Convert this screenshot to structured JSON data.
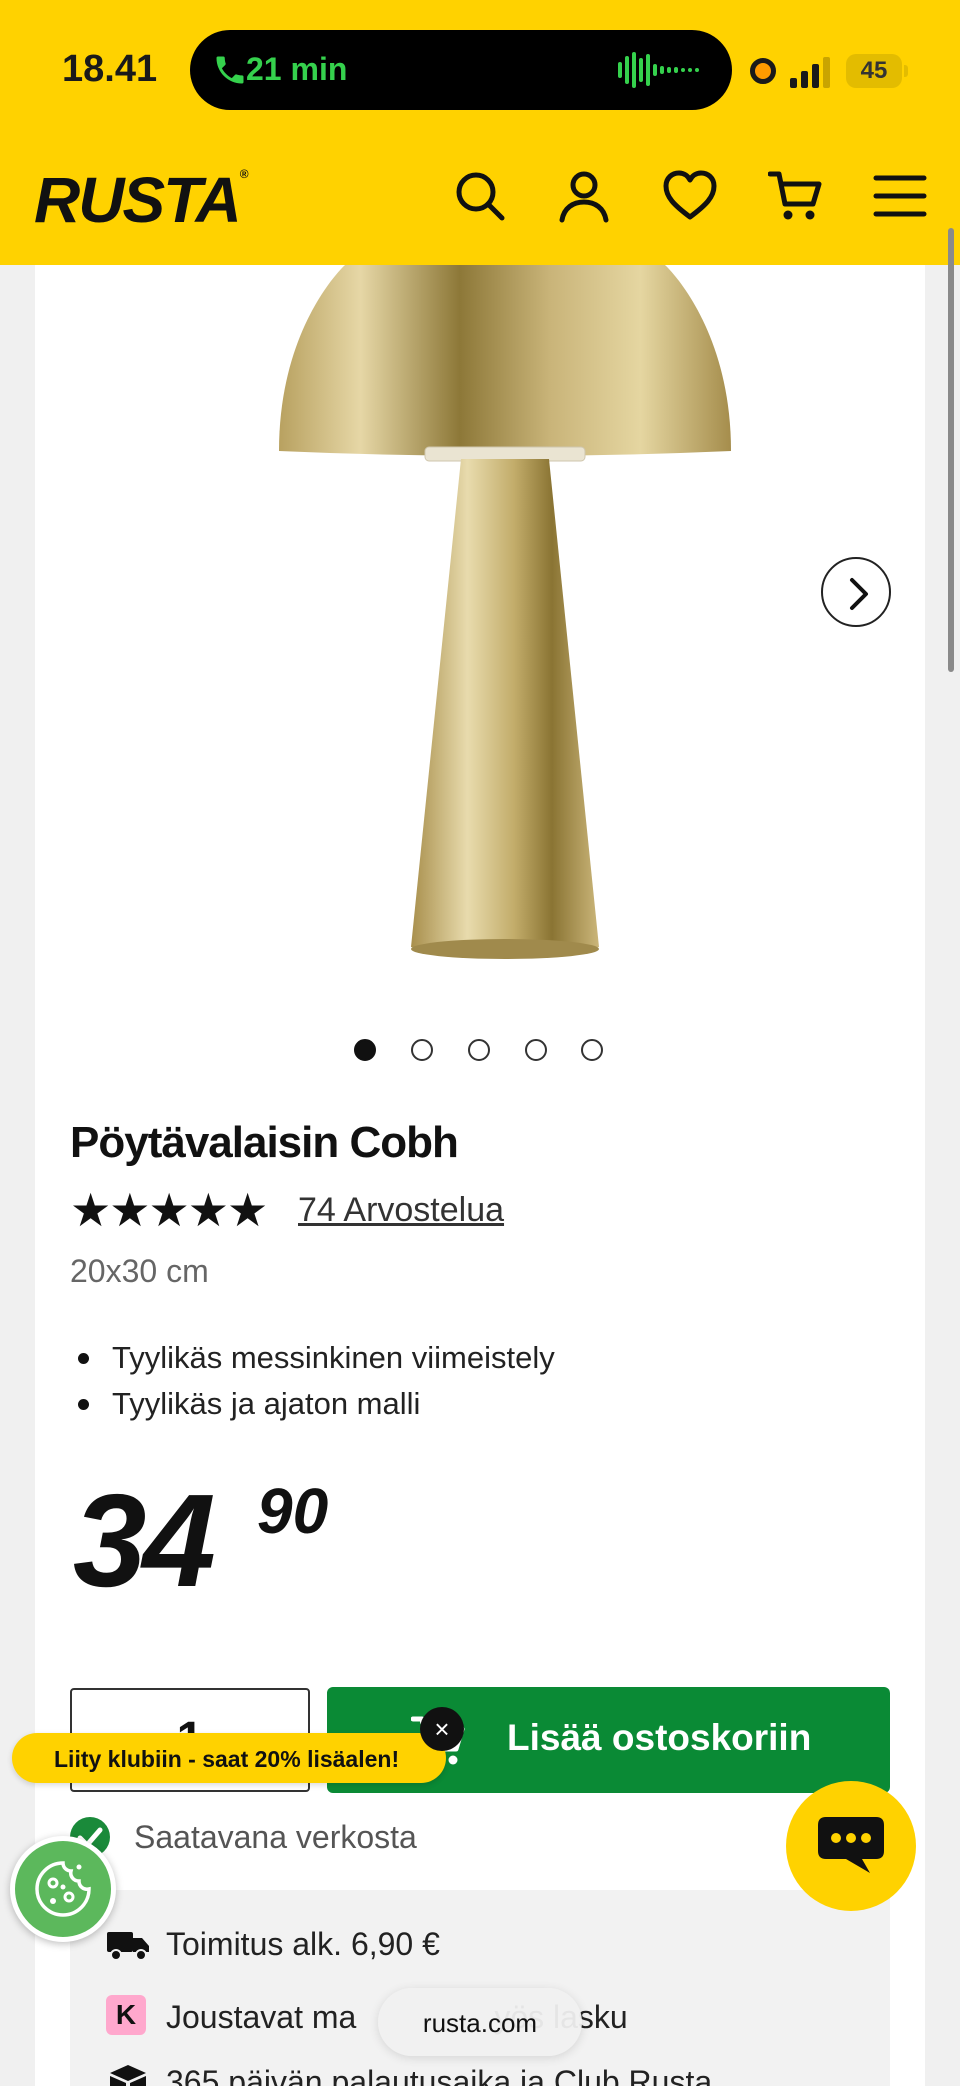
{
  "status_bar": {
    "time": "18.41",
    "call_duration": "21 min",
    "battery": "45"
  },
  "header": {
    "logo": "RUSTA",
    "icons": [
      "search-icon",
      "account-icon",
      "heart-icon",
      "cart-icon",
      "menu-icon"
    ]
  },
  "product": {
    "carousel_index": 1,
    "carousel_count": 5,
    "title": "Pöytävalaisin Cobh",
    "rating_stars": "★★★★★",
    "rating_value": 5,
    "reviews_label": "74 Arvostelua",
    "size": "20x30 cm",
    "features": [
      "Tyylikäs messinkinen viimeistely",
      "Tyylikäs ja ajaton malli"
    ],
    "price_whole": "34",
    "price_cents": "90"
  },
  "purchase": {
    "quantity": "1",
    "add_to_cart_label": "Lisää ostoskoriin",
    "availability": "Saatavana verkosta"
  },
  "info": {
    "delivery": "Toimitus alk. 6,90 €",
    "klarna_badge": "K",
    "payment_before": "Joustavat ma",
    "payment_after": "yös lasku",
    "returns": "365 päivän palautusaika ja Club Rusta"
  },
  "overlays": {
    "club_banner": "Liity klubiin - saat 20% lisäalen!",
    "club_close": "×",
    "url": "rusta.com"
  },
  "colors": {
    "brand_yellow": "#ffd200",
    "cta_green": "#0a8a35",
    "cookie_green": "#5cb85c"
  }
}
